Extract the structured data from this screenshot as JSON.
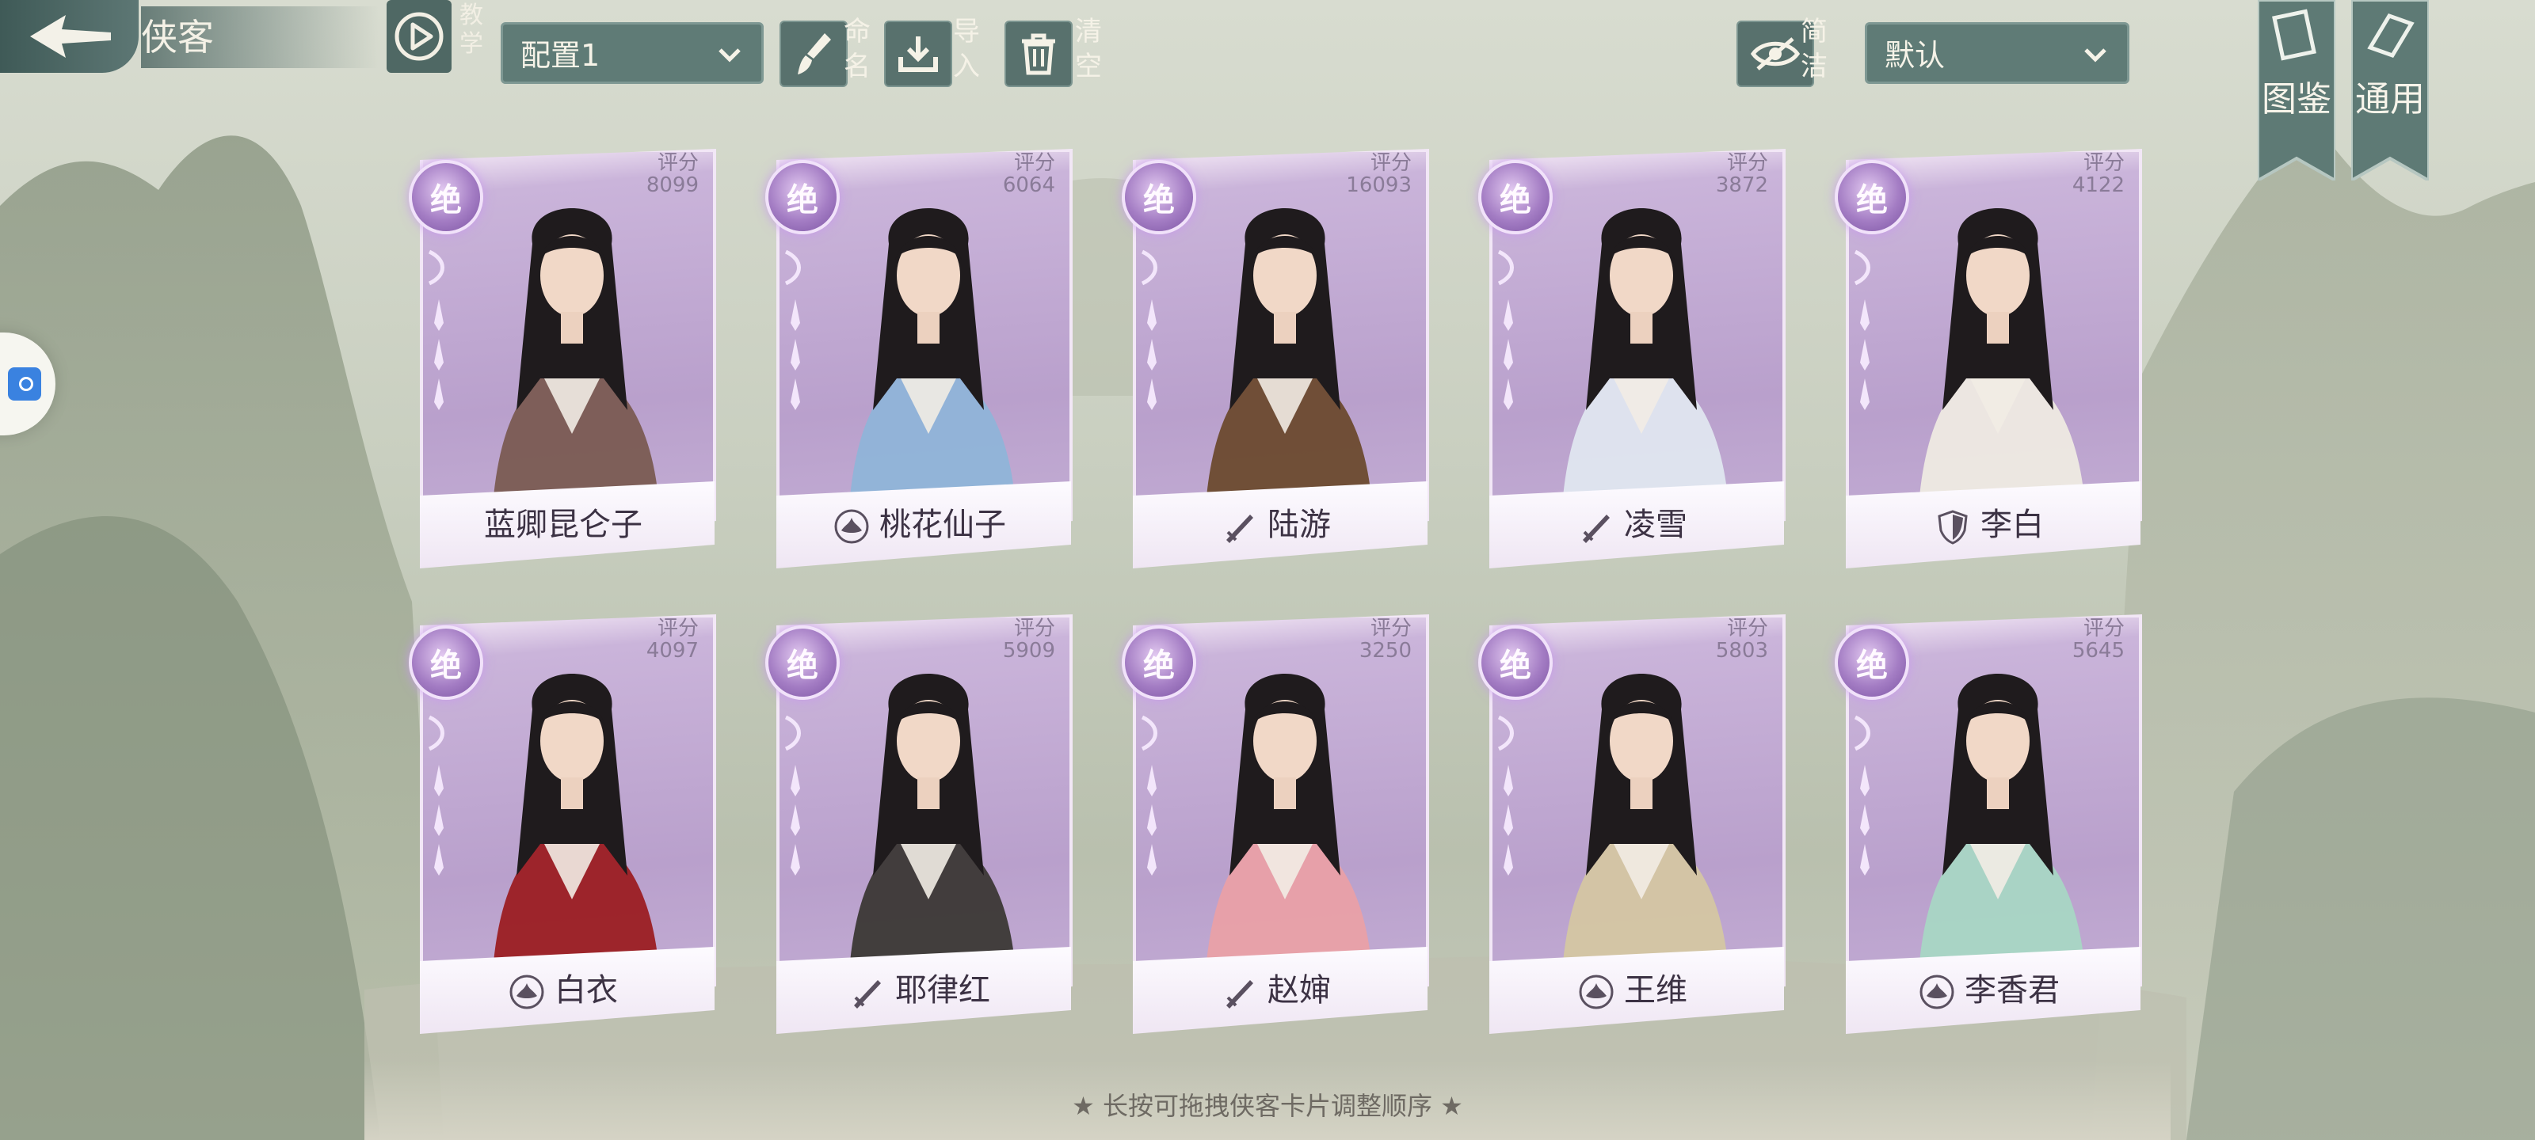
{
  "header": {
    "title": "侠客",
    "teach_label": "教学",
    "config_select": "配置1",
    "rename_label": "命名",
    "import_label": "导入",
    "clear_label": "清空",
    "simple_label": "简洁",
    "sort_select": "默认",
    "atlas_label": "图鉴",
    "general_label": "通用"
  },
  "cards": [
    {
      "rank": "绝",
      "score_label": "评分",
      "score": "8099",
      "name": "蓝卿昆仑子",
      "class_icon": "none"
    },
    {
      "rank": "绝",
      "score_label": "评分",
      "score": "6064",
      "name": "桃花仙子",
      "class_icon": "lotus-icon"
    },
    {
      "rank": "绝",
      "score_label": "评分",
      "score": "16093",
      "name": "陆游",
      "class_icon": "sword-icon"
    },
    {
      "rank": "绝",
      "score_label": "评分",
      "score": "3872",
      "name": "凌雪",
      "class_icon": "sword-icon"
    },
    {
      "rank": "绝",
      "score_label": "评分",
      "score": "4122",
      "name": "李白",
      "class_icon": "shield-icon"
    },
    {
      "rank": "绝",
      "score_label": "评分",
      "score": "4097",
      "name": "白衣",
      "class_icon": "lotus-icon"
    },
    {
      "rank": "绝",
      "score_label": "评分",
      "score": "5909",
      "name": "耶律红",
      "class_icon": "sword-icon"
    },
    {
      "rank": "绝",
      "score_label": "评分",
      "score": "3250",
      "name": "赵婶",
      "class_icon": "sword-icon"
    },
    {
      "rank": "绝",
      "score_label": "评分",
      "score": "5803",
      "name": "王维",
      "class_icon": "lotus-icon"
    },
    {
      "rank": "绝",
      "score_label": "评分",
      "score": "5645",
      "name": "李香君",
      "class_icon": "lotus-icon"
    }
  ],
  "footer": {
    "hint": "★ 长按可拖拽侠客卡片调整顺序 ★"
  },
  "colors": {
    "card_purple": "#b9a0cc",
    "toolbar_teal": "#5f7b76",
    "badge_purple": "#a47dc4"
  }
}
